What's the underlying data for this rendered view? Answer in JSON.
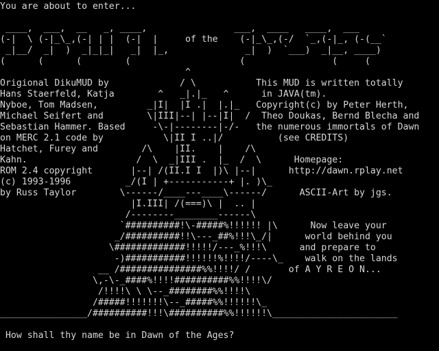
{
  "screen": {
    "lines": [
      "You are about to enter...",
      "",
      " ____,  ___,  __   _, ____,                ___,  ____   ____,  ___",
      "(-|  \\ (-|_\\_,(-| | |  (-|  |     of the    (-|_\\_,(-/  `_,(-|_, (-(__`",
      " _|__/  _|  )  _|_|_|   _|  |_,              _|  )  `___)  _|__, ____)",
      "(      (      (        (                    (                (     (",
      "                                  ^",
      "Origional DikuMUD by             / \\           This MUD is written totally",
      "Hans Staerfeld, Katja        ^   _|.|_   ^      in JAVA(tm).",
      "Nyboe, Tom Madsen,         _|I|  |I .|  |.|_   Copyright(c) by Peter Herth,",
      "Michael Seifert and        \\|III|--| |--|I|  /  Theo Doukas, Bernd Blecha and",
      "Sebastian Hammer. Based     -\\-|--------|-/-   the numerous immortals of Dawn",
      "on MERC 2.1 code by           \\|II I ..|/          (see CREDITS)",
      "Hatchet, Furey and        /\\    |II.    |    /\\",
      "Kahn.                    /  \\  _|III .  |_  /  \\      Homepage:",
      "ROM 2.4 copyright       |--| /(II.I I  |)\\ |--|      http://dawn.rplay.net",
      "(c) 1993-1996          _/(I | +-----------+ |. )\\_",
      "by Russ Taylor        \\------/____---____\\------/      ASCII-Art by jgs.",
      "                        |I.III| /(===)\\ |  .. |",
      "                       /--------________------\\",
      "                      `##########!\\-#####%!!!!!! |\\      Now leave your",
      "                     _/##########!!\\---_##%!!!\\_/|      world behind you",
      "                    \\#############!!!!!/---_%!!!\\      and prepare to",
      "                     -)###########!!!!!!%!!!!/----\\_    walk on the lands",
      "                  __ /###############%%!!!!/ /       of A Y R E O N...",
      "                 \\,-\\-_####%!!!!##########%%!!!!\\/",
      "                  /!!!!\\ \\ \\--_########%%!!!!\\",
      "                 /#####!!!!!!!\\--_#####%%!!!!!!\\_",
      "________________/##########!!!\\##########%%!!!!!!\\_______________________",
      "",
      " How shall thy name be in Dawn of the Ages?"
    ],
    "fg_color": "#d8d8d8",
    "bg_color": "#000000"
  }
}
